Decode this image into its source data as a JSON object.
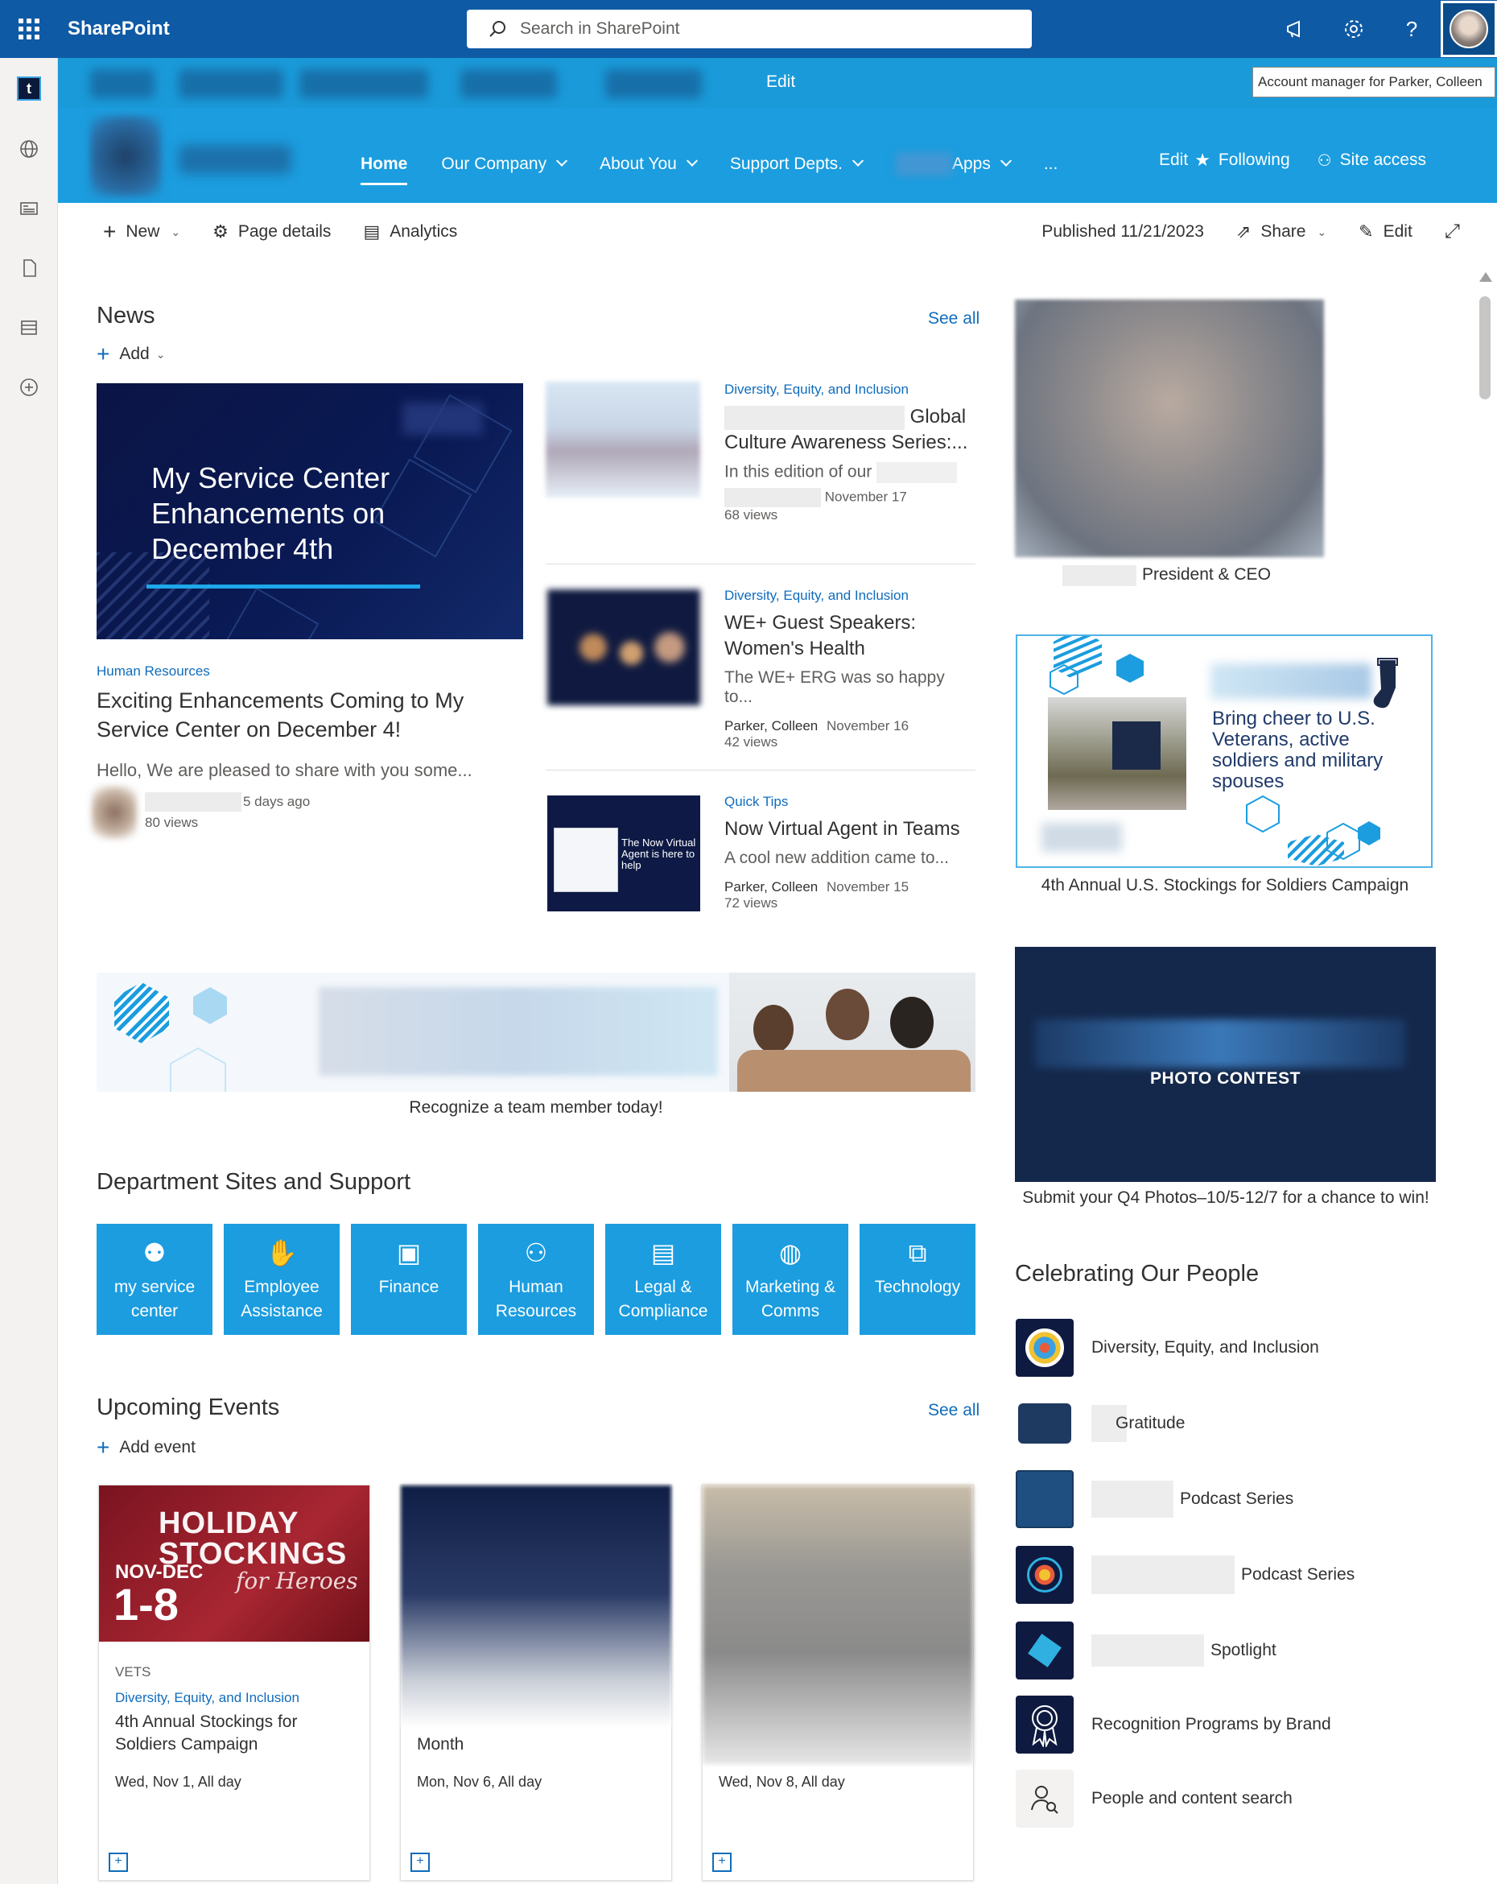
{
  "suite": {
    "brand": "SharePoint",
    "search_placeholder": "Search in SharePoint",
    "help_label": "?"
  },
  "hub": {
    "edit_label": "Edit",
    "tooltip": "Account manager for Parker, Colleen"
  },
  "site_nav": {
    "items": [
      {
        "label": "Home",
        "has_menu": false,
        "active": true
      },
      {
        "label": "Our Company",
        "has_menu": true
      },
      {
        "label": "About You",
        "has_menu": true
      },
      {
        "label": "Support Depts.",
        "has_menu": true
      },
      {
        "label": "Apps",
        "has_menu": true
      }
    ],
    "more_label": "...",
    "edit_label": "Edit",
    "following_label": "Following",
    "site_access_label": "Site access"
  },
  "command_bar": {
    "new_label": "New",
    "page_details_label": "Page details",
    "analytics_label": "Analytics",
    "published_label": "Published 11/21/2023",
    "share_label": "Share",
    "edit_label": "Edit"
  },
  "news": {
    "title": "News",
    "see_all": "See all",
    "add_label": "Add",
    "hero": {
      "image_text_lines": [
        "My Service Center",
        "Enhancements on",
        "December 4th"
      ],
      "category": "Human Resources",
      "title": "Exciting Enhancements Coming to My Service Center on December 4!",
      "description": "Hello, We are pleased to share with you some...",
      "time": "5 days ago",
      "views": "80 views"
    },
    "items": [
      {
        "category": "Diversity, Equity, and Inclusion",
        "title_line1": "Global",
        "title_line2": "Culture Awareness Series:...",
        "description": "In this edition of our",
        "author": "",
        "date": "November 17",
        "views": "68 views"
      },
      {
        "category": "Diversity, Equity, and Inclusion",
        "title_line1": "WE+ Guest Speakers:",
        "title_line2": "Women's Health",
        "description": "The WE+ ERG was so happy to...",
        "author": "Parker, Colleen",
        "date": "November 16",
        "views": "42 views"
      },
      {
        "category": "Quick Tips",
        "title_line1": "Now Virtual Agent in Teams",
        "title_line2": "",
        "description": "A cool new addition came to...",
        "author": "Parker, Colleen",
        "date": "November 15",
        "views": "72 views",
        "thumb_text": "The Now Virtual Agent is here to help"
      }
    ]
  },
  "banner": {
    "caption": "Recognize a team member today!"
  },
  "departments": {
    "title": "Department Sites and Support",
    "tiles": [
      {
        "label": "my service center",
        "icon": "people-service-icon"
      },
      {
        "label": "Employee Assistance",
        "icon": "hand-icon"
      },
      {
        "label": "Finance",
        "icon": "money-icon"
      },
      {
        "label": "Human Resources",
        "icon": "people-icon"
      },
      {
        "label": "Legal & Compliance",
        "icon": "document-icon"
      },
      {
        "label": "Marketing & Comms",
        "icon": "globe-icon"
      },
      {
        "label": "Technology",
        "icon": "devices-icon"
      }
    ]
  },
  "events": {
    "title": "Upcoming Events",
    "see_all": "See all",
    "add_label": "Add event",
    "items": [
      {
        "img_title_line1": "HOLIDAY",
        "img_title_line2": "STOCKINGS",
        "img_script": "for Heroes",
        "img_range": "NOV-DEC",
        "img_days": "1-8",
        "label": "VETS",
        "category": "Diversity, Equity, and Inclusion",
        "title": "4th Annual Stockings for Soldiers Campaign",
        "date": "Wed, Nov 1, All day"
      },
      {
        "label": "",
        "category": "",
        "title": "Month",
        "date": "Mon, Nov 6, All day"
      },
      {
        "label": "",
        "category": "",
        "title": "",
        "date": "Wed, Nov 8, All day"
      }
    ]
  },
  "right": {
    "ceo_caption": "President & CEO",
    "stockings_text": "Bring cheer to U.S. Veterans, active soldiers and military spouses",
    "stockings_caption": "4th Annual U.S. Stockings for Soldiers Campaign",
    "photo_contest_text": "PHOTO CONTEST",
    "photo_contest_caption": "Submit your Q4 Photos–10/5-12/7 for a chance to win!",
    "people_title": "Celebrating Our People",
    "people_items": [
      {
        "label": "Diversity, Equity, and Inclusion"
      },
      {
        "label": "Gratitude"
      },
      {
        "label": "Podcast Series"
      },
      {
        "label": "Podcast Series"
      },
      {
        "label": "Spotlight"
      },
      {
        "label": "Recognition Programs by Brand"
      },
      {
        "label": "People and content search"
      }
    ]
  },
  "colors": {
    "suite_bar": "#0f5aa5",
    "hub_bar": "#1a9ad9",
    "header": "#1b9ddf",
    "accent": "#0f6cbd",
    "tile": "#1b9ddf"
  }
}
